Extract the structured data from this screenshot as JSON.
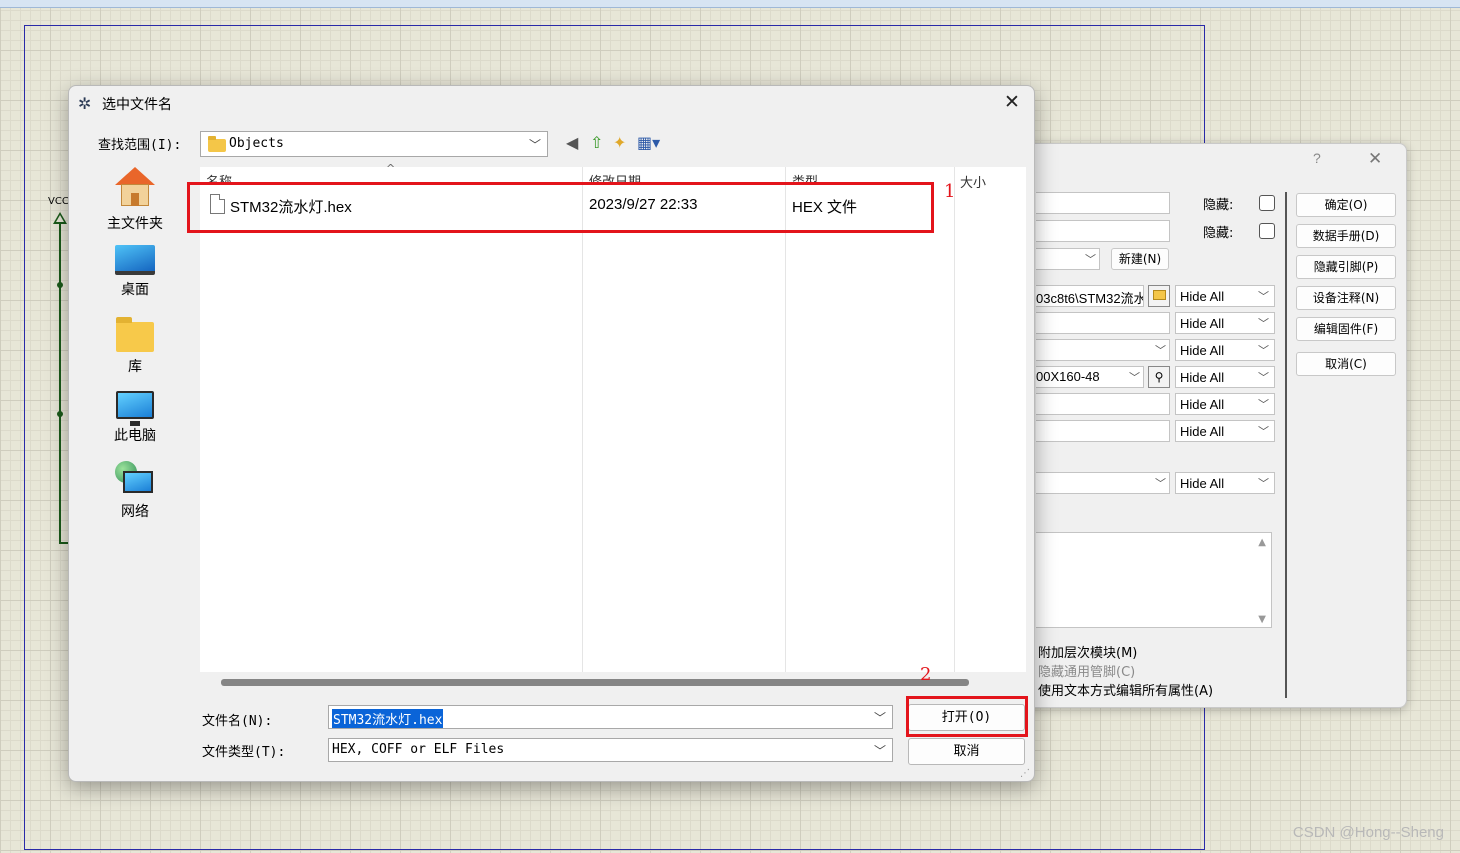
{
  "schematic": {
    "vcc_label": "VCC",
    "watermark": "CSDN @Hong--Sheng"
  },
  "properties_dialog": {
    "help": "?",
    "close": "✕",
    "hidden_label_1": "隐藏:",
    "hidden_label_2": "隐藏:",
    "new_button": "新建(N)",
    "program_file_value": "03c8t6\\STM32流水",
    "package_value": "00X160-48",
    "hide_all_options": [
      "Hide All",
      "Hide All",
      "Hide All",
      "Hide All",
      "Hide All",
      "Hide All",
      "Hide All"
    ],
    "buttons": [
      "确定(O)",
      "数据手册(D)",
      "隐藏引脚(P)",
      "设备注释(N)",
      "编辑固件(F)",
      "取消(C)"
    ],
    "options": {
      "attach_hierarchy": "附加层次模块(M)",
      "hide_common_pins": "隐藏通用管脚(C)",
      "edit_as_text": "使用文本方式编辑所有属性(A)"
    }
  },
  "file_dialog": {
    "title": "选中文件名",
    "look_in_label": "查找范围(I):",
    "look_in_value": "Objects",
    "places": [
      {
        "label": "主文件夹"
      },
      {
        "label": "桌面"
      },
      {
        "label": "库"
      },
      {
        "label": "此电脑"
      },
      {
        "label": "网络"
      }
    ],
    "columns": {
      "name": "名称",
      "modified": "修改日期",
      "type": "类型",
      "size": "大小"
    },
    "files": [
      {
        "name": "STM32流水灯.hex",
        "modified": "2023/9/27 22:33",
        "type": "HEX 文件",
        "size": ""
      }
    ],
    "filename_label": "文件名(N):",
    "filename_value": "STM32流水灯.hex",
    "filetype_label": "文件类型(T):",
    "filetype_value": "HEX, COFF or ELF Files",
    "open_button": "打开(O)",
    "cancel_button": "取消"
  },
  "annotations": {
    "marker_1": "1",
    "marker_2": "2",
    "color": "#e3141b"
  }
}
